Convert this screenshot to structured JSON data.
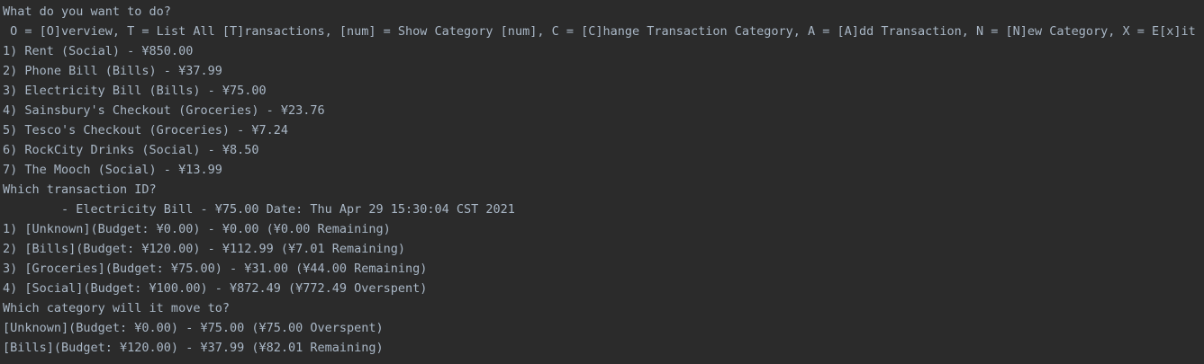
{
  "console": {
    "lines": [
      "What do you want to do?",
      " O = [O]verview, T = List All [T]ransactions, [num] = Show Category [num], C = [C]hange Transaction Category, A = [A]dd Transaction, N = [N]ew Category, X = E[x]it",
      "1) Rent (Social) - ¥850.00",
      "2) Phone Bill (Bills) - ¥37.99",
      "3) Electricity Bill (Bills) - ¥75.00",
      "4) Sainsbury's Checkout (Groceries) - ¥23.76",
      "5) Tesco's Checkout (Groceries) - ¥7.24",
      "6) RockCity Drinks (Social) - ¥8.50",
      "7) The Mooch (Social) - ¥13.99",
      "Which transaction ID?",
      "        - Electricity Bill - ¥75.00 Date: Thu Apr 29 15:30:04 CST 2021",
      "1) [Unknown](Budget: ¥0.00) - ¥0.00 (¥0.00 Remaining)",
      "2) [Bills](Budget: ¥120.00) - ¥112.99 (¥7.01 Remaining)",
      "3) [Groceries](Budget: ¥75.00) - ¥31.00 (¥44.00 Remaining)",
      "4) [Social](Budget: ¥100.00) - ¥872.49 (¥772.49 Overspent)",
      "Which category will it move to?",
      "[Unknown](Budget: ¥0.00) - ¥75.00 (¥75.00 Overspent)",
      "[Bills](Budget: ¥120.00) - ¥37.99 (¥82.01 Remaining)"
    ]
  },
  "colors": {
    "background": "#2b2b2b",
    "text": "#a9b7c6"
  }
}
